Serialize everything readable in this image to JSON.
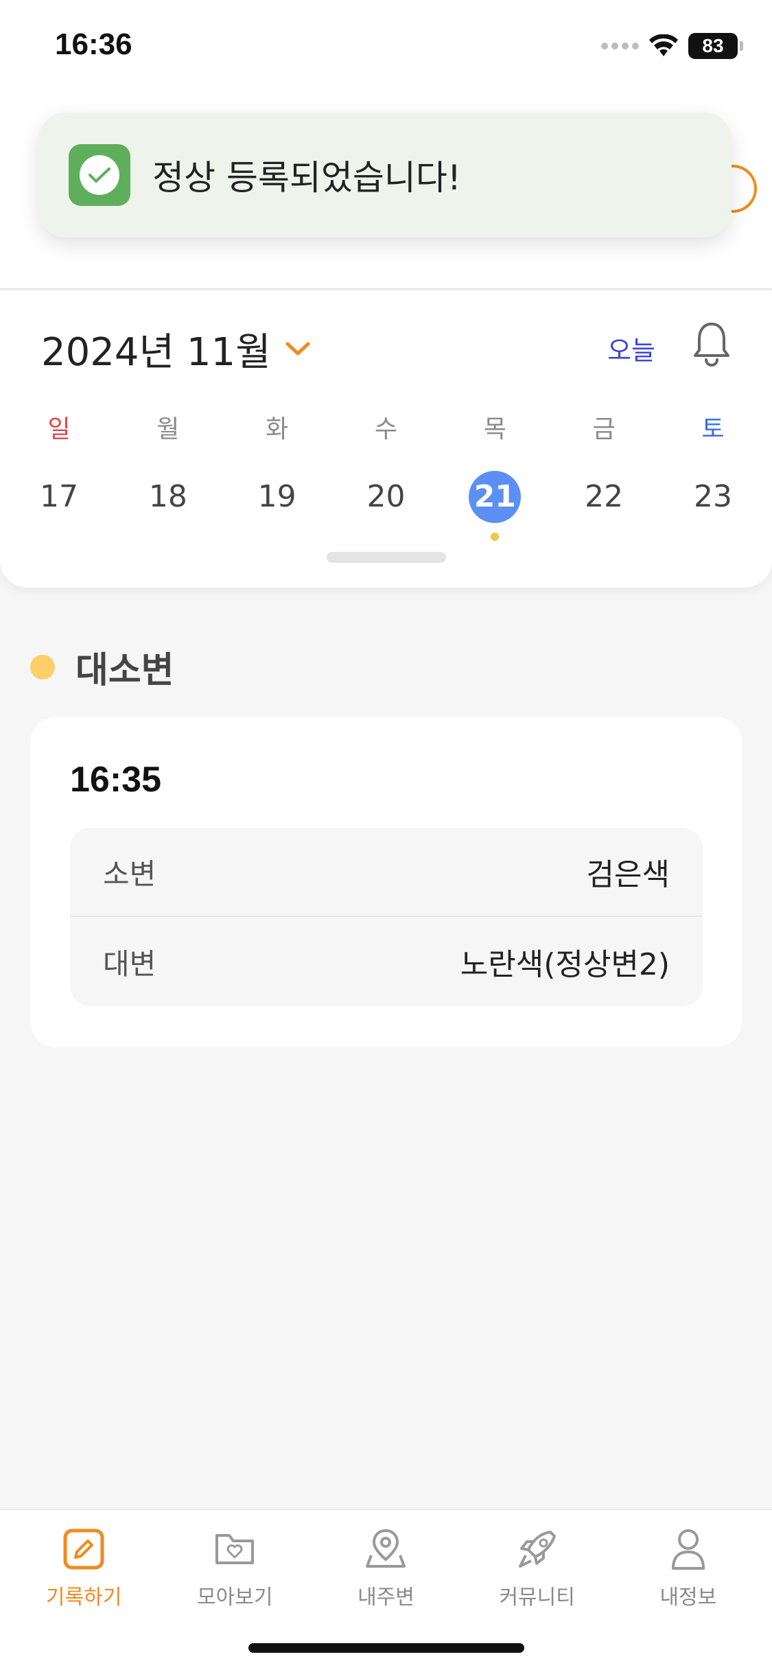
{
  "status_bar": {
    "time": "16:36",
    "battery": "83"
  },
  "toast": {
    "message": "정상 등록되었습니다!"
  },
  "calendar": {
    "month_label": "2024년 11월",
    "today_label": "오늘",
    "weekdays": [
      "일",
      "월",
      "화",
      "수",
      "목",
      "금",
      "토"
    ],
    "dates": [
      "17",
      "18",
      "19",
      "20",
      "21",
      "22",
      "23"
    ],
    "selected_date": "21"
  },
  "section": {
    "title": "대소변"
  },
  "record": {
    "time": "16:35",
    "rows": [
      {
        "label": "소변",
        "value": "검은색"
      },
      {
        "label": "대변",
        "value": "노란색(정상변2)"
      }
    ]
  },
  "bottom_nav": {
    "items": [
      {
        "label": "기록하기",
        "icon": "pencil-icon"
      },
      {
        "label": "모아보기",
        "icon": "folder-heart-icon"
      },
      {
        "label": "내주변",
        "icon": "location-pin-icon"
      },
      {
        "label": "커뮤니티",
        "icon": "rocket-icon"
      },
      {
        "label": "내정보",
        "icon": "person-icon"
      }
    ]
  },
  "colors": {
    "accent": "#f28a1c",
    "selected_date": "#5b8ff3",
    "sunday": "#e0474c",
    "saturday": "#3a6fe0",
    "toast_bg": "#eef4ec",
    "toast_icon": "#5fae5b",
    "today_link": "#3e47d0",
    "section_dot": "#fdcf68"
  }
}
